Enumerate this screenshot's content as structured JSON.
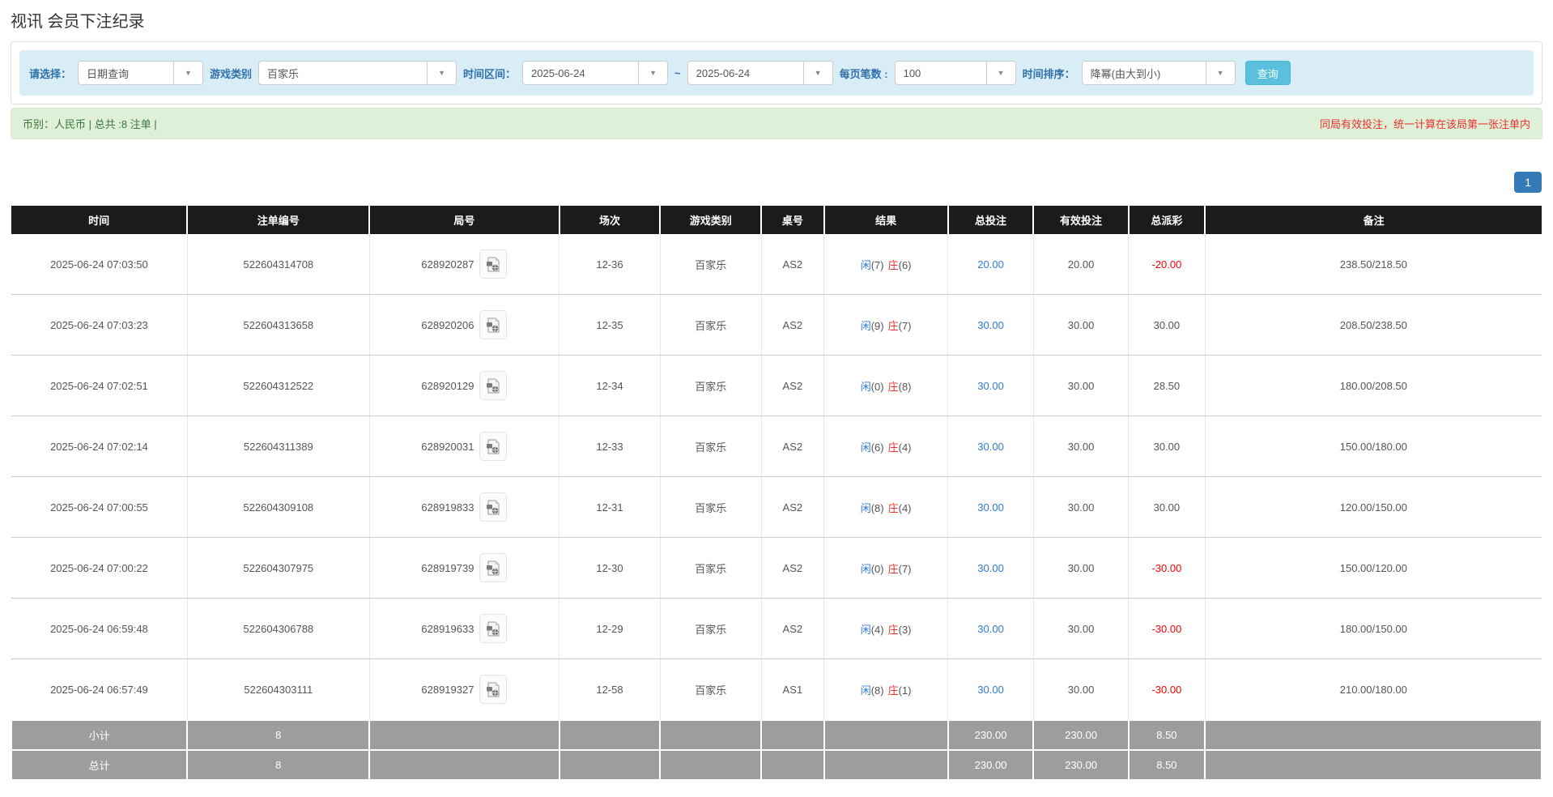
{
  "page": {
    "title": "视讯 会员下注纪录"
  },
  "filters": {
    "select_label": "请选择：",
    "select_value": "日期查询",
    "game_type_label": "游戏类别",
    "game_type_value": "百家乐",
    "time_range_label": "时间区间：",
    "date_from": "2025-06-24",
    "tilde": "~",
    "date_to": "2025-06-24",
    "page_size_label": "每页笔数 :",
    "page_size_value": "100",
    "sort_label": "时间排序：",
    "sort_value": "降幂(由大到小)",
    "search_button": "查询"
  },
  "summary_bar": {
    "left_text": "币别：人民币 | 总共 :8 注单 |",
    "right_text": "同局有效投注，统一计算在该局第一张注单内"
  },
  "pagination": {
    "current": "1"
  },
  "colors": {
    "accent_blue": "#3079d6",
    "banker_red": "#e9322d",
    "negative_red": "#ff0000",
    "green_text": "#3c763d",
    "query_button": "#5bc0de",
    "header_black": "#1b1b1b",
    "summary_gray": "#9d9d9d"
  },
  "table": {
    "columns": [
      {
        "label": "时间"
      },
      {
        "label": "注单编号"
      },
      {
        "label": "局号"
      },
      {
        "label": "场次"
      },
      {
        "label": "游戏类别"
      },
      {
        "label": "桌号"
      },
      {
        "label": "结果"
      },
      {
        "label": "总投注"
      },
      {
        "label": "有效投注"
      },
      {
        "label": "总派彩"
      },
      {
        "label": "备注"
      }
    ],
    "rows": [
      {
        "time": "2025-06-24 07:03:50",
        "bet_id": "522604314708",
        "round_id": "628920287",
        "session": "12-36",
        "game_type": "百家乐",
        "table_no": "AS2",
        "result": {
          "player_label": "闲",
          "player_num": "(7)",
          "banker_label": "庄",
          "banker_num": "(6)"
        },
        "total_bet": "20.00",
        "valid_bet": "20.00",
        "payout": "-20.00",
        "remark": "238.50/218.50"
      },
      {
        "time": "2025-06-24 07:03:23",
        "bet_id": "522604313658",
        "round_id": "628920206",
        "session": "12-35",
        "game_type": "百家乐",
        "table_no": "AS2",
        "result": {
          "player_label": "闲",
          "player_num": "(9)",
          "banker_label": "庄",
          "banker_num": "(7)"
        },
        "total_bet": "30.00",
        "valid_bet": "30.00",
        "payout": "30.00",
        "remark": "208.50/238.50"
      },
      {
        "time": "2025-06-24 07:02:51",
        "bet_id": "522604312522",
        "round_id": "628920129",
        "session": "12-34",
        "game_type": "百家乐",
        "table_no": "AS2",
        "result": {
          "player_label": "闲",
          "player_num": "(0)",
          "banker_label": "庄",
          "banker_num": "(8)"
        },
        "total_bet": "30.00",
        "valid_bet": "30.00",
        "payout": "28.50",
        "remark": "180.00/208.50"
      },
      {
        "time": "2025-06-24 07:02:14",
        "bet_id": "522604311389",
        "round_id": "628920031",
        "session": "12-33",
        "game_type": "百家乐",
        "table_no": "AS2",
        "result": {
          "player_label": "闲",
          "player_num": "(6)",
          "banker_label": "庄",
          "banker_num": "(4)"
        },
        "total_bet": "30.00",
        "valid_bet": "30.00",
        "payout": "30.00",
        "remark": "150.00/180.00"
      },
      {
        "time": "2025-06-24 07:00:55",
        "bet_id": "522604309108",
        "round_id": "628919833",
        "session": "12-31",
        "game_type": "百家乐",
        "table_no": "AS2",
        "result": {
          "player_label": "闲",
          "player_num": "(8)",
          "banker_label": "庄",
          "banker_num": "(4)"
        },
        "total_bet": "30.00",
        "valid_bet": "30.00",
        "payout": "30.00",
        "remark": "120.00/150.00"
      },
      {
        "time": "2025-06-24 07:00:22",
        "bet_id": "522604307975",
        "round_id": "628919739",
        "session": "12-30",
        "game_type": "百家乐",
        "table_no": "AS2",
        "result": {
          "player_label": "闲",
          "player_num": "(0)",
          "banker_label": "庄",
          "banker_num": "(7)"
        },
        "total_bet": "30.00",
        "valid_bet": "30.00",
        "payout": "-30.00",
        "remark": "150.00/120.00"
      },
      {
        "time": "2025-06-24 06:59:48",
        "bet_id": "522604306788",
        "round_id": "628919633",
        "session": "12-29",
        "game_type": "百家乐",
        "table_no": "AS2",
        "result": {
          "player_label": "闲",
          "player_num": "(4)",
          "banker_label": "庄",
          "banker_num": "(3)"
        },
        "total_bet": "30.00",
        "valid_bet": "30.00",
        "payout": "-30.00",
        "remark": "180.00/150.00"
      },
      {
        "time": "2025-06-24 06:57:49",
        "bet_id": "522604303111",
        "round_id": "628919327",
        "session": "12-58",
        "game_type": "百家乐",
        "table_no": "AS1",
        "result": {
          "player_label": "闲",
          "player_num": "(8)",
          "banker_label": "庄",
          "banker_num": "(1)"
        },
        "total_bet": "30.00",
        "valid_bet": "30.00",
        "payout": "-30.00",
        "remark": "210.00/180.00"
      }
    ],
    "subtotal": {
      "label": "小计",
      "count": "8",
      "total_bet": "230.00",
      "valid_bet": "230.00",
      "payout": "8.50"
    },
    "grand_total": {
      "label": "总计",
      "count": "8",
      "total_bet": "230.00",
      "valid_bet": "230.00",
      "payout": "8.50"
    }
  }
}
